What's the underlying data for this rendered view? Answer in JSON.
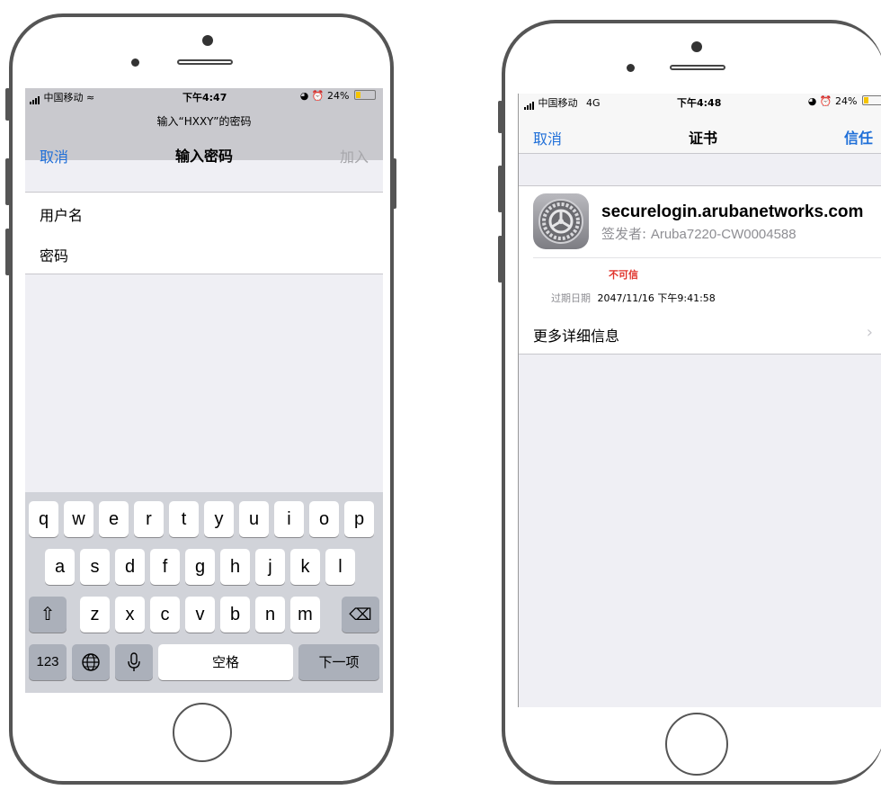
{
  "left_phone": {
    "status": {
      "carrier": "中国移动",
      "time": "下午4:47",
      "battery": "24%"
    },
    "prompt": "输入“HXXY”的密码",
    "nav": {
      "cancel": "取消",
      "title": "输入密码",
      "join": "加入"
    },
    "fields": {
      "username": "用户名",
      "password": "密码"
    },
    "keyboard": {
      "row1": [
        "q",
        "w",
        "e",
        "r",
        "t",
        "y",
        "u",
        "i",
        "o",
        "p"
      ],
      "row2": [
        "a",
        "s",
        "d",
        "f",
        "g",
        "h",
        "j",
        "k",
        "l"
      ],
      "row3": [
        "z",
        "x",
        "c",
        "v",
        "b",
        "n",
        "m"
      ],
      "shift": "⇧",
      "backspace": "⌫",
      "numbers": "123",
      "globe": "🌐",
      "mic": "🎙",
      "space": "空格",
      "next": "下一项"
    }
  },
  "right_phone": {
    "status": {
      "carrier": "中国移动",
      "network": "4G",
      "time": "下午4:48",
      "battery": "24%"
    },
    "nav": {
      "cancel": "取消",
      "title": "证书",
      "trust": "信任"
    },
    "certificate": {
      "domain": "securelogin.arubanetworks.com",
      "issuer_label": "签发者:",
      "issuer": "Aruba7220-CW0004588",
      "status": "不可信",
      "expiry_label": "过期日期",
      "expiry": "2047/11/16 下午9:41:58"
    },
    "more_details": "更多详细信息"
  },
  "colors": {
    "accent": "#1f6fd8",
    "untrusted": "#e0332b",
    "nav_gray": "#c9c9ce",
    "group_bg": "#efeff4"
  }
}
